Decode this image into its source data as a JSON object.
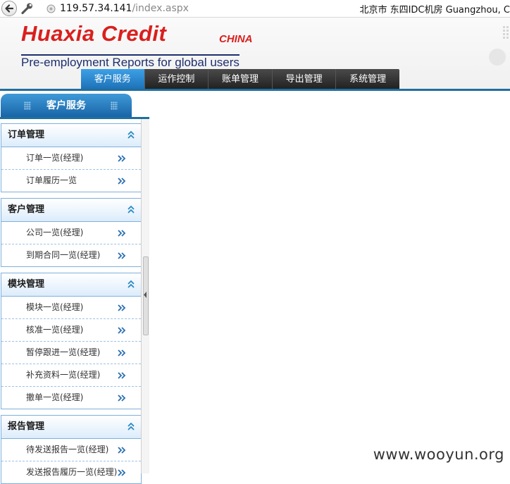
{
  "browser": {
    "url_host": "119.57.34.141",
    "url_path": "/index.aspx",
    "location": "北京市 东四IDC机房   Guangzhou, C"
  },
  "header": {
    "logo_main": "Huaxia Credit",
    "logo_china": "CHINA",
    "logo_sub": "Pre-employment Reports for global users"
  },
  "nav": {
    "tabs": [
      "客户服务",
      "运作控制",
      "账单管理",
      "导出管理",
      "系统管理"
    ],
    "active": 0
  },
  "sidebar": {
    "title": "客户服务",
    "groups": [
      {
        "title": "订单管理",
        "items": [
          "订单一览(经理)",
          "订单履历一览"
        ]
      },
      {
        "title": "客户管理",
        "items": [
          "公司一览(经理)",
          "到期合同一览(经理)"
        ]
      },
      {
        "title": "模块管理",
        "items": [
          "模块一览(经理)",
          "核准一览(经理)",
          "暂停跟进一览(经理)",
          "补充资料一览(经理)",
          "撤单一览(经理)"
        ]
      },
      {
        "title": "报告管理",
        "items": [
          "待发送报告一览(经理)",
          "发送报告履历一览(经理)"
        ]
      }
    ]
  },
  "watermark": "www.wooyun.org",
  "colors": {
    "logo_red": "#d9201e",
    "logo_blue": "#1d2f6e",
    "nav_active": "#1b6fb5",
    "sidebar_border": "#7fb0dc"
  }
}
